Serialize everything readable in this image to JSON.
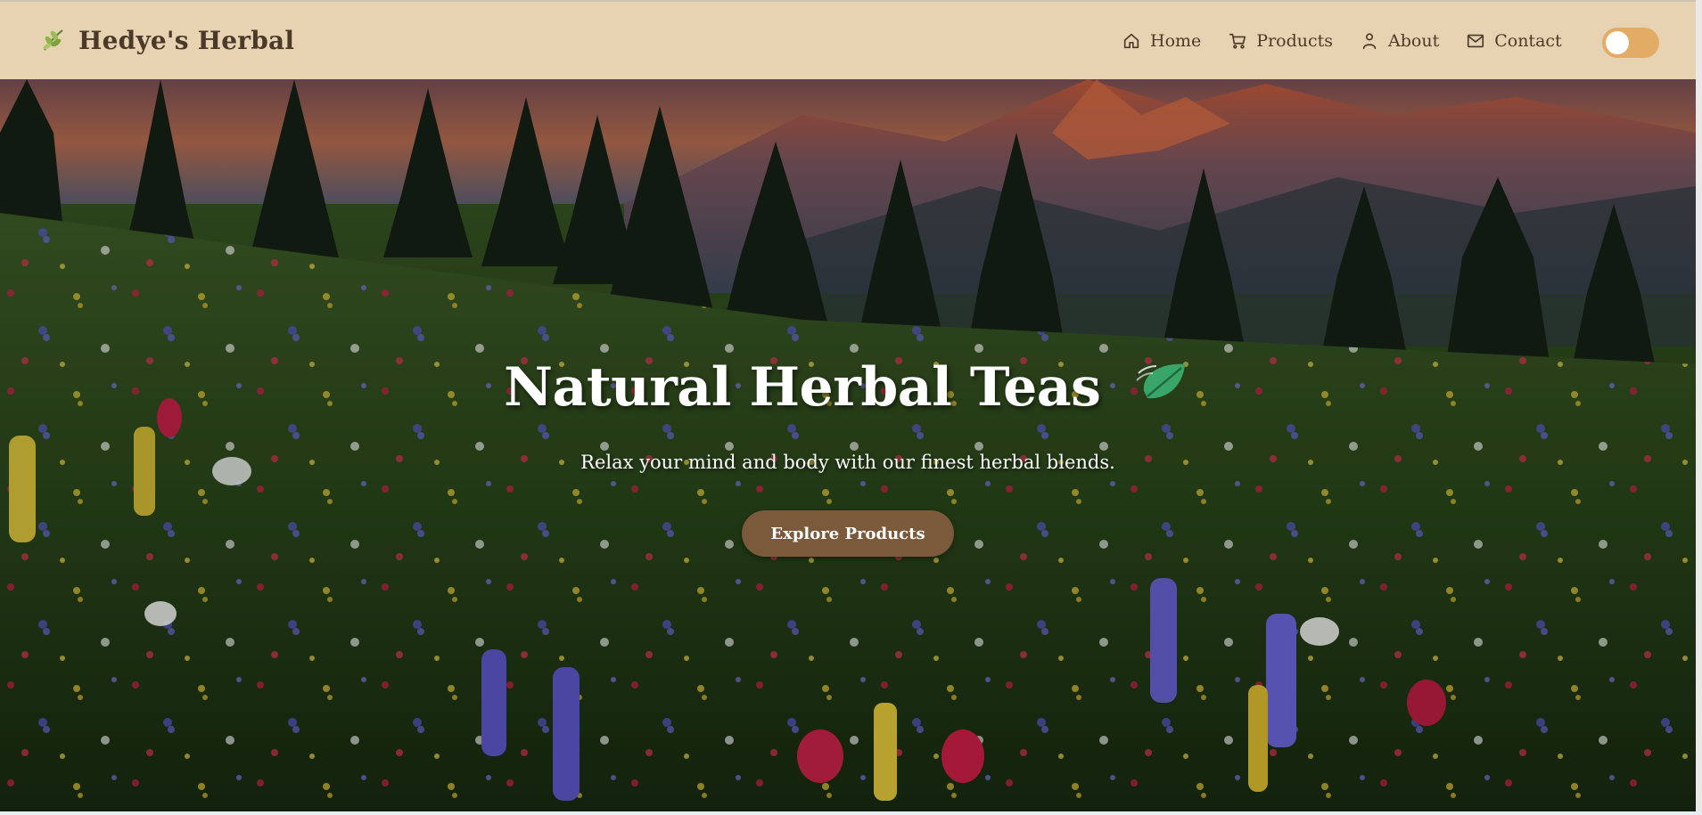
{
  "brand": {
    "title": "Hedye's Herbal",
    "icon": "herb-sprig-icon"
  },
  "nav": {
    "items": [
      {
        "label": "Home",
        "icon": "home-icon"
      },
      {
        "label": "Products",
        "icon": "cart-icon"
      },
      {
        "label": "About",
        "icon": "user-icon"
      },
      {
        "label": "Contact",
        "icon": "mail-icon"
      }
    ],
    "theme_toggle": {
      "state": "off"
    }
  },
  "hero": {
    "title": "Natural Herbal Teas",
    "title_icon": "leaf-fluttering-icon",
    "subtitle": "Relax your mind and body with our finest herbal blends.",
    "button_label": "Explore Products",
    "background": "wildflower-meadow-mountains-photo"
  },
  "colors": {
    "header_bg": "#e7d2b1",
    "brand_text": "#4b3a2a",
    "toggle_bg": "#e3ac66",
    "button_bg": "#7b5a3c"
  }
}
